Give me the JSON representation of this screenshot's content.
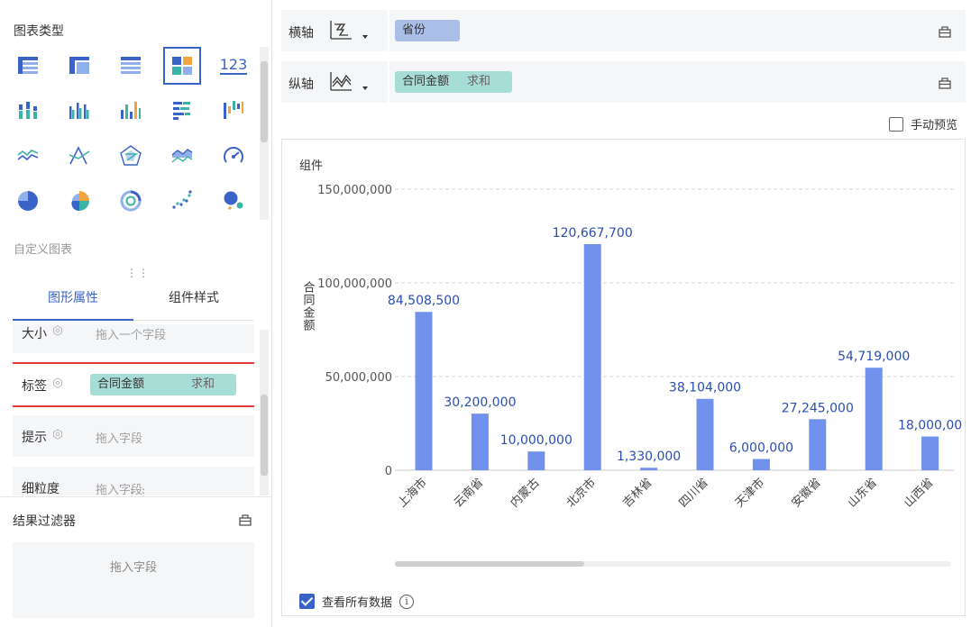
{
  "left": {
    "chart_type_title": "图表类型",
    "chart_type_icons": [
      "table-icon",
      "cross-table-icon",
      "detail-table-icon",
      "multi-panel-icon",
      "kpi-number-icon",
      "stacked-column-icon",
      "grouped-column-icon",
      "column-icon",
      "bar-icon",
      "waterfall-icon",
      "line-icon",
      "radar-line-icon",
      "radar-icon",
      "area-icon",
      "gauge-icon",
      "pie-icon",
      "rose-pie-icon",
      "ring-icon",
      "scatter-icon",
      "bubble-icon"
    ],
    "kpi_icon_text": "123",
    "custom_chart_label": "自定义图表",
    "tabs": [
      {
        "label": "图形属性",
        "active": true
      },
      {
        "label": "组件样式",
        "active": false
      }
    ],
    "props": [
      {
        "label": "大小",
        "hint": "拖入一个字段"
      },
      {
        "label": "标签",
        "field": "合同金额",
        "agg": "求和"
      },
      {
        "label": "提示",
        "hint": "拖入字段"
      },
      {
        "label": "细粒度",
        "hint": "拖入字段"
      }
    ],
    "filter": {
      "title": "结果过滤器",
      "hint": "拖入字段"
    }
  },
  "axes": {
    "x_label": "横轴",
    "x_field": "省份",
    "y_label": "纵轴",
    "y_field": "合同金额",
    "y_agg": "求和"
  },
  "manual_preview": "手动预览",
  "component_title": "组件",
  "view_all": "查看所有数据",
  "colors": {
    "bar": "#7191ec",
    "label": "#2b4fb0",
    "accent": "#3a63c8",
    "x_pill": "#a9bfe8",
    "y_pill": "#a7ddd7"
  },
  "chart_data": {
    "type": "bar",
    "ylabel": "合同金额",
    "ylim": [
      0,
      150000000
    ],
    "yticks": [
      "0",
      "50,000,000",
      "100,000,000",
      "150,000,000"
    ],
    "categories": [
      "上海市",
      "云南省",
      "内蒙古",
      "北京市",
      "吉林省",
      "四川省",
      "天津市",
      "安徽省",
      "山东省",
      "山西省"
    ],
    "values": [
      84508500,
      30200000,
      10000000,
      120667700,
      1330000,
      38104000,
      6000000,
      27245000,
      54719000,
      18000000
    ],
    "data_labels": [
      "84,508,500",
      "30,200,000",
      "10,000,000",
      "120,667,700",
      "1,330,000",
      "38,104,000",
      "6,000,000",
      "27,245,000",
      "54,719,000",
      "18,000,00"
    ],
    "grid": true
  }
}
